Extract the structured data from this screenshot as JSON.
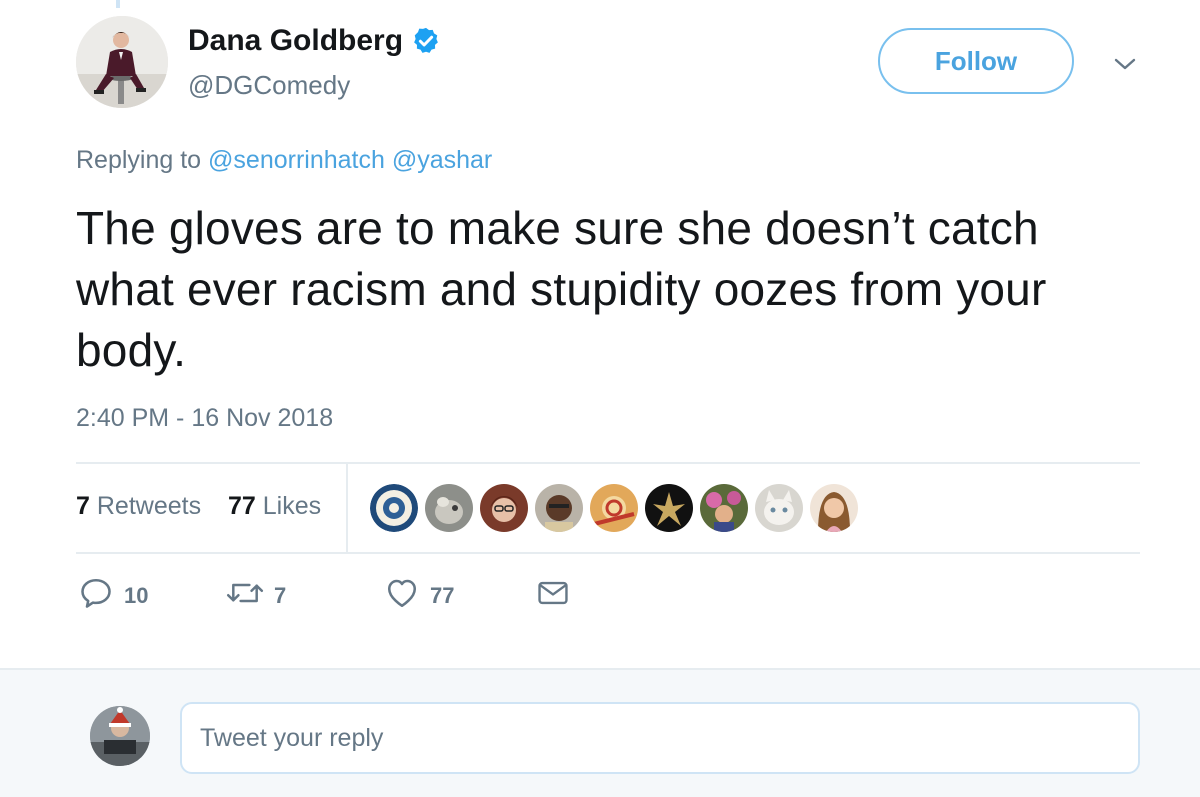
{
  "tweet": {
    "author": {
      "display_name": "Dana Goldberg",
      "handle": "@DGComedy",
      "verified": true
    },
    "follow_label": "Follow",
    "replying_prefix": "Replying to",
    "replying_to": [
      "@senorrinhatch",
      "@yashar"
    ],
    "text": "The gloves are to make sure she doesn’t catch what ever racism and stupidity oozes from your body.",
    "timestamp": "2:40 PM - 16 Nov 2018",
    "stats": {
      "retweets_count": "7",
      "retweets_label": "Retweets",
      "likes_count": "77",
      "likes_label": "Likes"
    },
    "likers_count_shown": 9,
    "actions": {
      "reply_count": "10",
      "retweet_count": "7",
      "like_count": "77"
    }
  },
  "reply_box": {
    "placeholder": "Tweet your reply"
  },
  "colors": {
    "link_blue": "#4aa3df",
    "follow_border": "#79c0ee",
    "muted_text": "#657786",
    "divider": "#e6ecf0",
    "reply_bg": "#f5f8fa"
  }
}
